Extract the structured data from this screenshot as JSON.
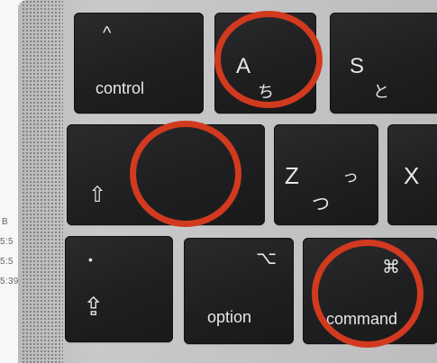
{
  "keys": {
    "control": {
      "glyph": "^",
      "label": "control"
    },
    "a": {
      "latin": "A",
      "kana": "ち"
    },
    "s": {
      "latin": "S",
      "kana": "と"
    },
    "shift": {
      "glyph": "⇧"
    },
    "z": {
      "latin": "Z",
      "kana_small": "っ",
      "kana": "つ"
    },
    "x": {
      "latin": "X"
    },
    "fn": {
      "dot": "•",
      "glyph": "⇪"
    },
    "option": {
      "glyph": "⌥",
      "label": "option"
    },
    "command": {
      "glyph": "⌘",
      "label": "command"
    }
  },
  "background_text": [
    "B",
    "5:5",
    "5:5",
    "5:39"
  ],
  "annotation_color": "#d13a1e"
}
